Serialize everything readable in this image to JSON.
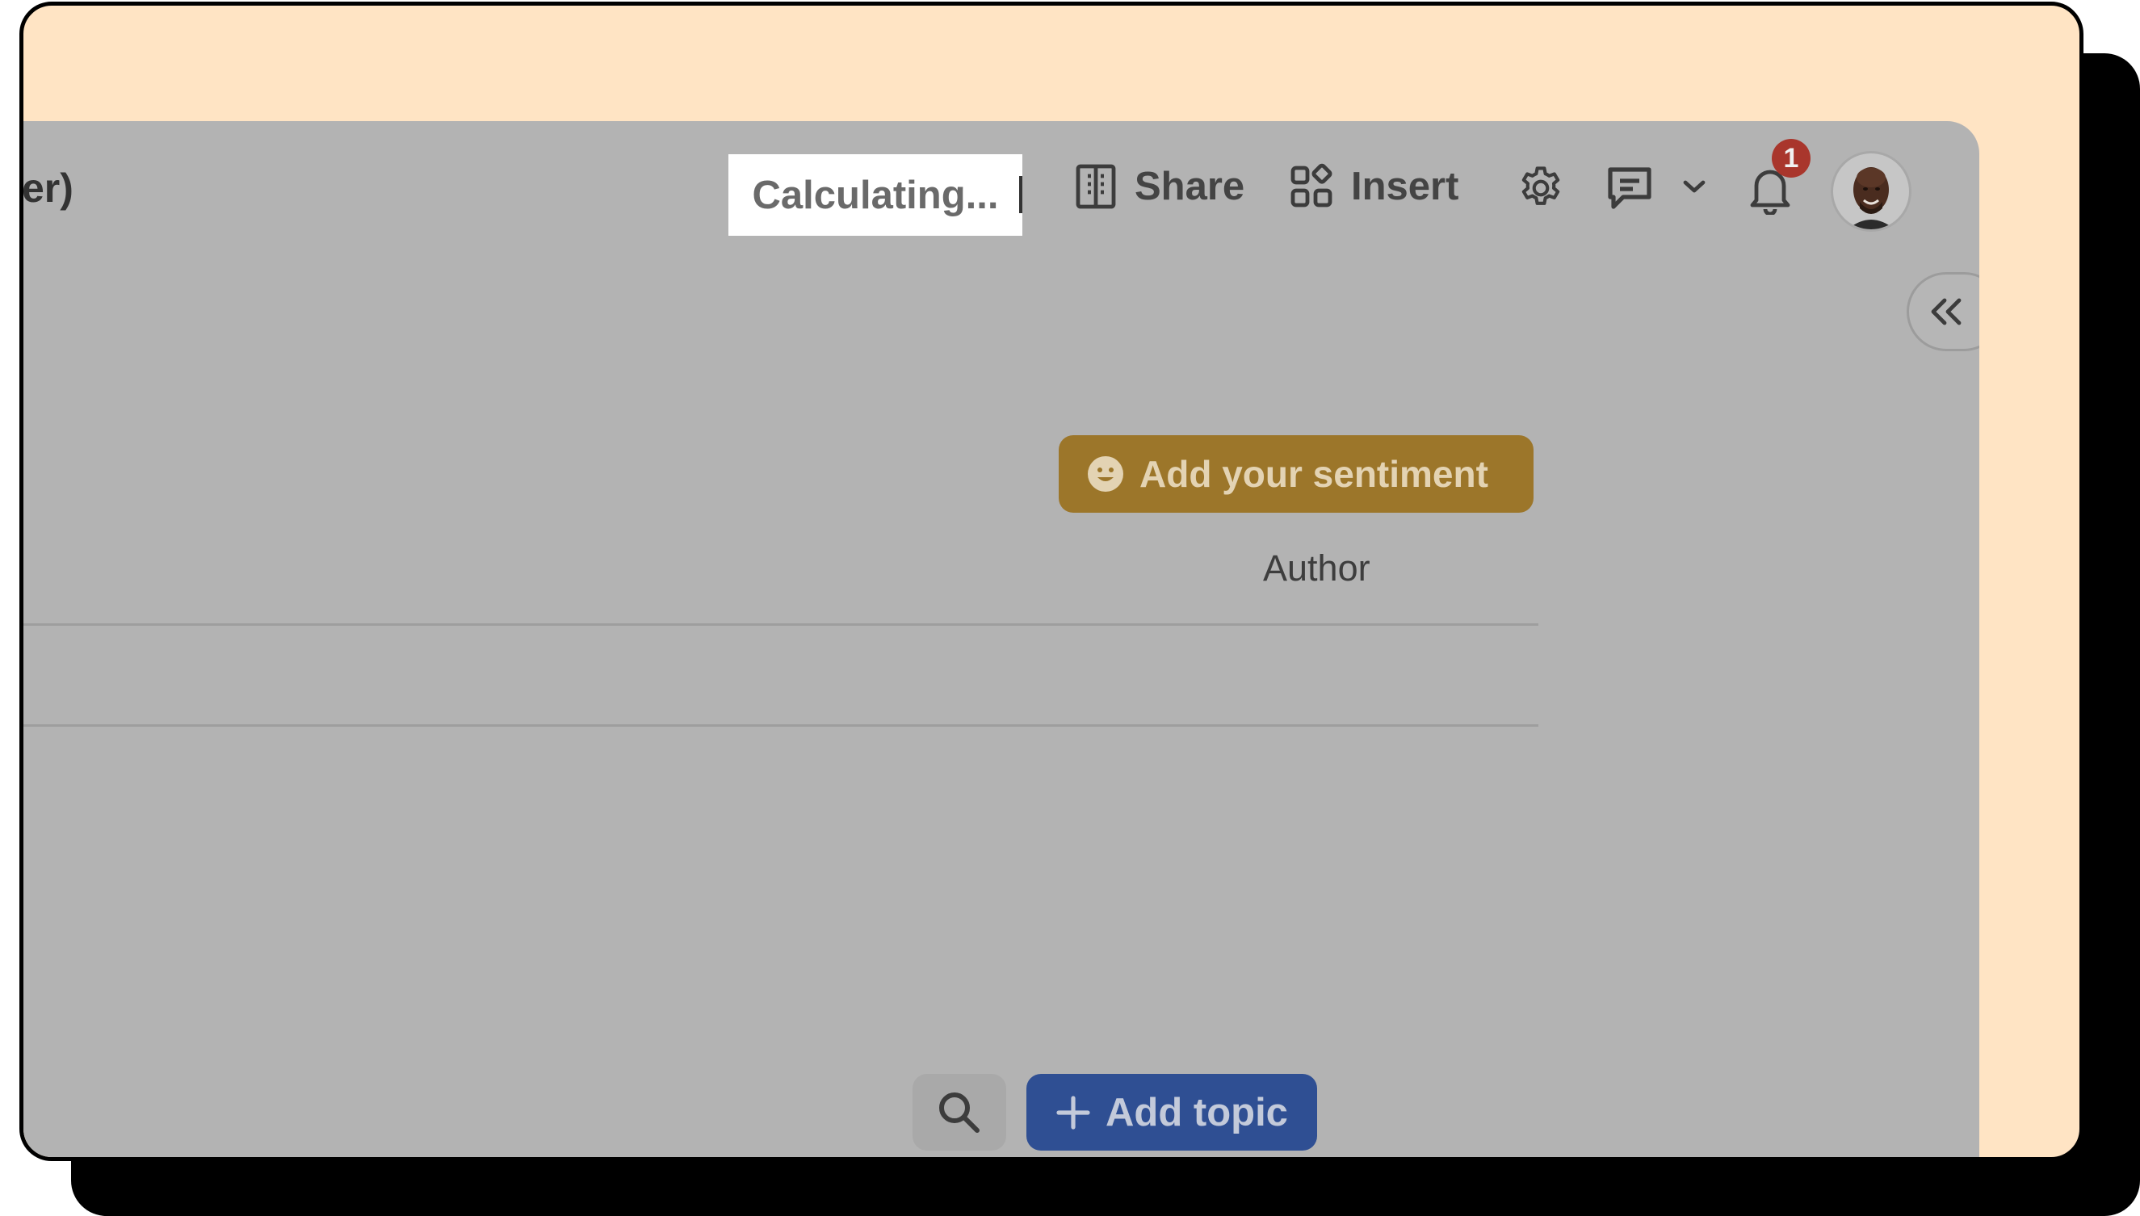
{
  "header": {
    "doc_title_fragment": "er)",
    "status": "Calculating...",
    "share_label": "Share",
    "insert_label": "Insert",
    "notification_count": "1"
  },
  "content": {
    "sentiment_button_label": "Add your sentiment",
    "columns": [
      "Author"
    ]
  },
  "footer": {
    "add_topic_label": "Add topic"
  },
  "colors": {
    "frame_bg": "#ffe4c4",
    "overlay": "#b3b3b3",
    "sentiment_button": "#9c762a",
    "add_topic_button": "#2f4f93",
    "badge": "#a9362c"
  },
  "icons": [
    "building-icon",
    "insert-grid-icon",
    "gear-icon",
    "comment-icon",
    "chevron-down-icon",
    "bell-icon",
    "chevrons-left-icon",
    "smiley-icon",
    "search-icon",
    "plus-icon"
  ]
}
